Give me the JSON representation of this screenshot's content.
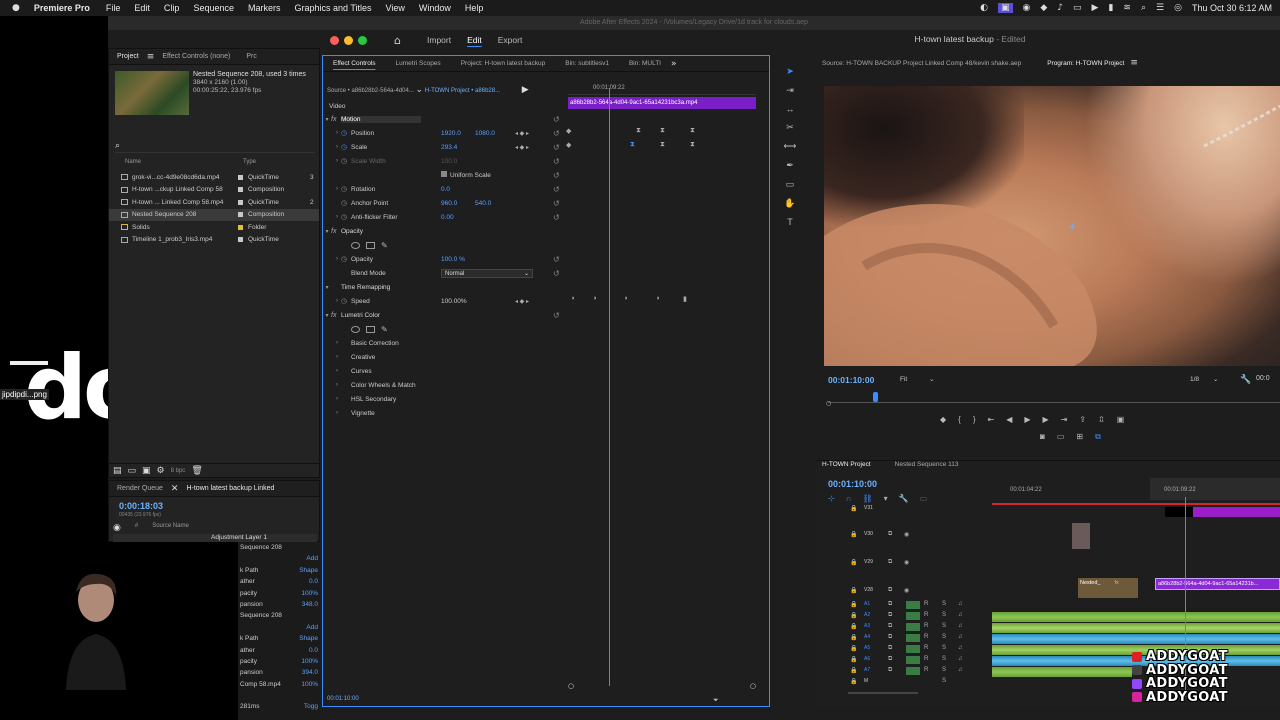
{
  "menubar": {
    "app_name": "Premiere Pro",
    "items": [
      "File",
      "Edit",
      "Clip",
      "Sequence",
      "Markers",
      "Graphics and Titles",
      "View",
      "Window",
      "Help"
    ],
    "clock": "Thu Oct 30  6:12 AM"
  },
  "window_title_behind": "Adobe After Effects 2024 - /Volumes/Legacy Drive/1d track for clouds.aep",
  "desktop": {
    "file_label": "jipdipdi...png"
  },
  "workspace": {
    "tabs": [
      "Import",
      "Edit",
      "Export"
    ],
    "active": "Edit",
    "title": "H-town latest backup",
    "edited": " - Edited"
  },
  "project_panel": {
    "tabs": [
      "Project",
      "Effect Controls (none)",
      "Prc"
    ],
    "selected_meta": {
      "name": "Nested Sequence 208",
      "used": ", used 3 times",
      "res": "3840 x 2160 (1.00)",
      "dur": "00:00:25:22, 23.976 fps"
    },
    "columns": [
      "Name",
      "Type"
    ],
    "items": [
      {
        "name": "grok-vi...cc-4d9e08cd6da.mp4",
        "type": "QuickTime",
        "color": "#c8c8c8",
        "extra": "3"
      },
      {
        "name": "H-town ...ckup Linked Comp 58",
        "type": "Composition",
        "color": "#c8c8c8",
        "extra": ""
      },
      {
        "name": "H-town ... Linked Comp 58.mp4",
        "type": "QuickTime",
        "color": "#c8c8c8",
        "extra": "2"
      },
      {
        "name": "Nested Sequence 208",
        "type": "Composition",
        "color": "#c8c8c8",
        "extra": ""
      },
      {
        "name": "Solids",
        "type": "Folder",
        "color": "#e0c030",
        "extra": ""
      },
      {
        "name": "Timeline 1_prob3_Iris3.mp4",
        "type": "QuickTime",
        "color": "#c8c8c8",
        "extra": ""
      }
    ],
    "bit_depth": "8 bpc"
  },
  "render_panel": {
    "tabs": [
      "Render Queue",
      "H-town latest backup Linked"
    ],
    "timecode": "0:00:18:03",
    "fps": "00435 (23.976 fps)",
    "columns": [
      "#",
      "Source Name"
    ],
    "row": "Adjustment Layer 1"
  },
  "ae_props": [
    {
      "l": "Sequence 208",
      "v": ""
    },
    {
      "l": "",
      "v": "Add"
    },
    {
      "l": "k Path",
      "v": "Shape"
    },
    {
      "l": "ather",
      "v": "0.0"
    },
    {
      "l": "pacity",
      "v": "100%"
    },
    {
      "l": "pansion",
      "v": "348.0"
    },
    {
      "l": "Sequence 208",
      "v": ""
    },
    {
      "l": "",
      "v": "Add"
    },
    {
      "l": "k Path",
      "v": "Shape"
    },
    {
      "l": "ather",
      "v": "0.0"
    },
    {
      "l": "pacity",
      "v": "100%"
    },
    {
      "l": "pansion",
      "v": "394.0"
    },
    {
      "l": "Comp 58.mp4",
      "v": "100%"
    },
    {
      "l": "",
      "v": ""
    },
    {
      "l": "281ms",
      "v": "Togg"
    }
  ],
  "effect_controls": {
    "tabs": [
      "Effect Controls",
      "Lumetri Scopes",
      "Project: H-town latest backup",
      "Bin: subtitlesv1",
      "Bin: MULTI"
    ],
    "source": "Source • a86b28b2-564a-4d04...",
    "sequence": "H-TOWN Project • a86b28...",
    "ruler_time": "00:01:09:22",
    "clip_name": "a86b28b2-564a-4d04-9ac1-65a14231bc3a.mp4",
    "video_label": "Video",
    "props": {
      "motion": "Motion",
      "position": "Position",
      "position_x": "1920.0",
      "position_y": "1080.0",
      "scale": "Scale",
      "scale_v": "293.4",
      "scale_width": "Scale Width",
      "scale_width_v": "100.0",
      "uniform": "Uniform Scale",
      "rotation": "Rotation",
      "rotation_v": "0.0",
      "anchor": "Anchor Point",
      "anchor_x": "960.0",
      "anchor_y": "540.0",
      "antiflicker": "Anti-flicker Filter",
      "antiflicker_v": "0.00",
      "opacity_h": "Opacity",
      "opacity": "Opacity",
      "opacity_v": "100.0 %",
      "blend": "Blend Mode",
      "blend_v": "Normal",
      "timeremap": "Time Remapping",
      "speed": "Speed",
      "speed_v": "100.00%",
      "lumetri": "Lumetri Color",
      "basic": "Basic Correction",
      "creative": "Creative",
      "curves": "Curves",
      "wheels": "Color Wheels & Match",
      "hsl": "HSL Secondary",
      "vignette": "Vignette"
    },
    "footer_tc": "00:01:10:00"
  },
  "program": {
    "tabs": [
      "Source: H-TOWN BACKUP Project Linked Comp 48/kevin shake.aep",
      "Program: H-TOWN Project"
    ],
    "timecode": "00:01:10:00",
    "fit": "Fit",
    "res": "1/8",
    "tc_right": "00:0"
  },
  "timeline": {
    "tabs": [
      "H-TOWN Project",
      "Nested Sequence 113"
    ],
    "timecode": "00:01:10:00",
    "ruler": [
      "00:01:04:22",
      "00:01:09:22"
    ],
    "video_tracks": [
      "V31",
      "V30",
      "V29",
      "V28"
    ],
    "audio_tracks": [
      "A1",
      "A2",
      "A3",
      "A4",
      "A5",
      "A6",
      "A7",
      "M"
    ],
    "clips": {
      "nested": "Nested_",
      "purple": "a86b28b2-564a-4d04-9ac1-65a14231b..."
    }
  },
  "overlay": {
    "channels": [
      {
        "name": "ADDYGOAT",
        "color": "#e02020"
      },
      {
        "name": "ADDYGOAT",
        "color": "#444444"
      },
      {
        "name": "ADDYGOAT",
        "color": "#9146ff"
      },
      {
        "name": "ADDYGOAT",
        "color": "#d6249f"
      }
    ]
  }
}
